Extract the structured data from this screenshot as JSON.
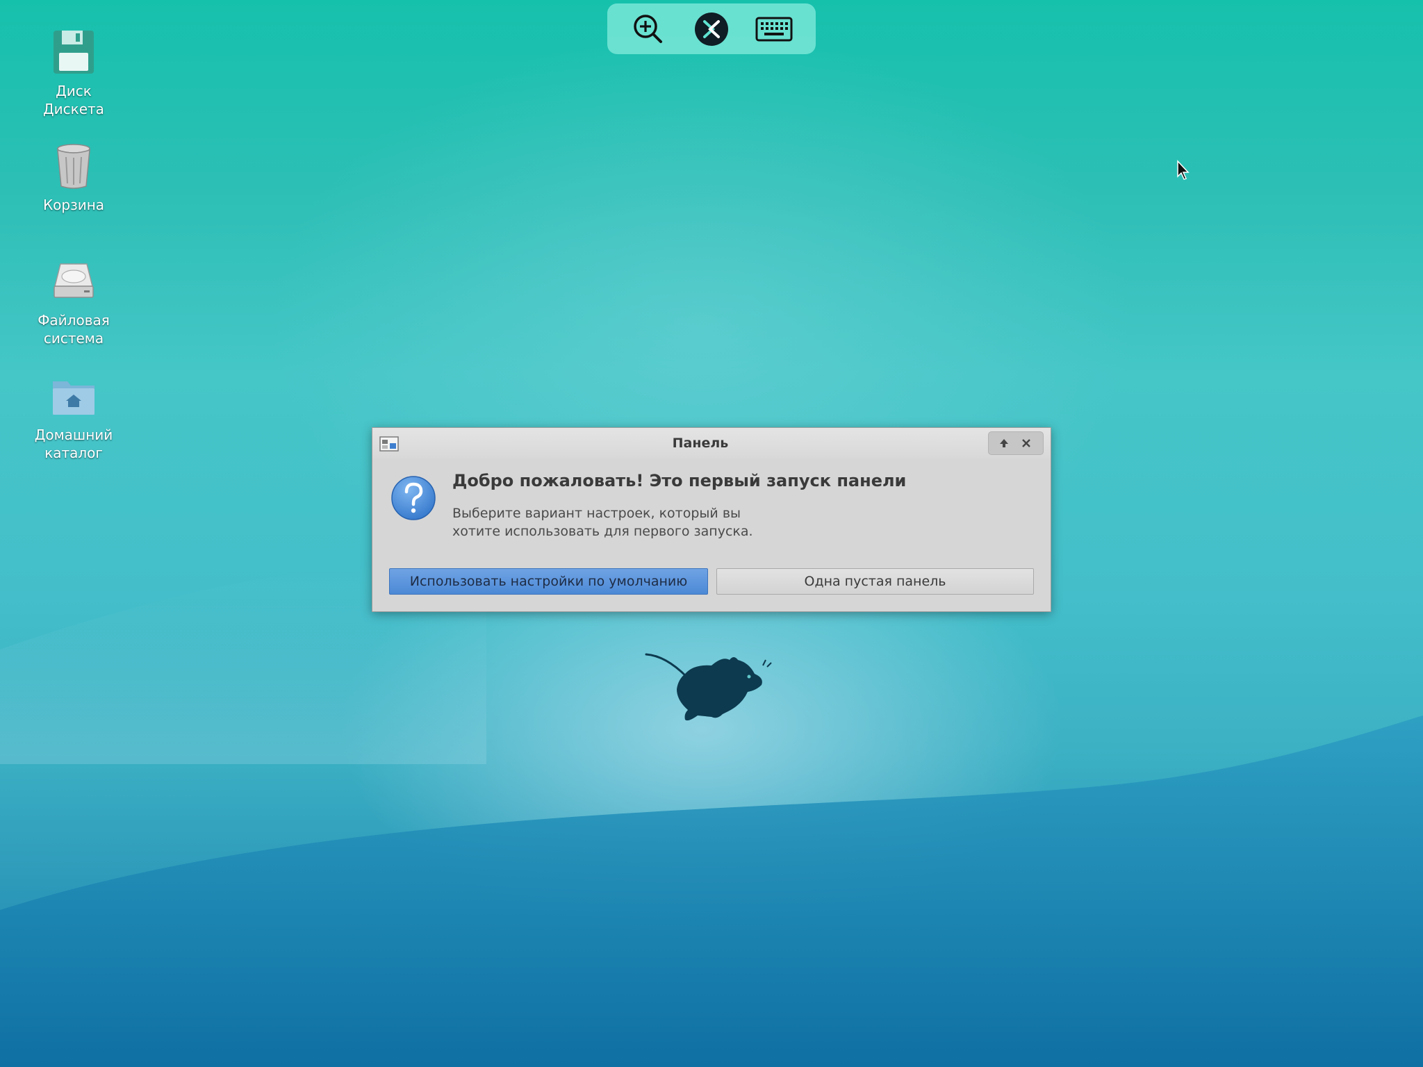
{
  "remote_toolbar": {
    "icons": [
      "zoom-in-icon",
      "remote-connection-icon",
      "keyboard-icon"
    ]
  },
  "desktop": {
    "icons": [
      {
        "label": "Диск\nДискета",
        "icon": "floppy-disk-icon"
      },
      {
        "label": "Корзина",
        "icon": "trash-icon"
      },
      {
        "label": "Файловая\nсистема",
        "icon": "hard-drive-icon"
      },
      {
        "label": "Домашний\nкаталог",
        "icon": "home-folder-icon"
      }
    ]
  },
  "dialog": {
    "title": "Панель",
    "heading": "Добро пожаловать! Это первый запуск панели",
    "body_line1": "Выберите вариант настроек, который вы",
    "body_line2": "хотите использовать для первого запуска.",
    "primary_button": "Использовать настройки по умолчанию",
    "secondary_button": "Одна пустая панель",
    "icon": "question-icon"
  },
  "colors": {
    "accent_button": "#5b94dc",
    "desktop_top": "#16c1ac",
    "desktop_bottom": "#1a7fab"
  }
}
